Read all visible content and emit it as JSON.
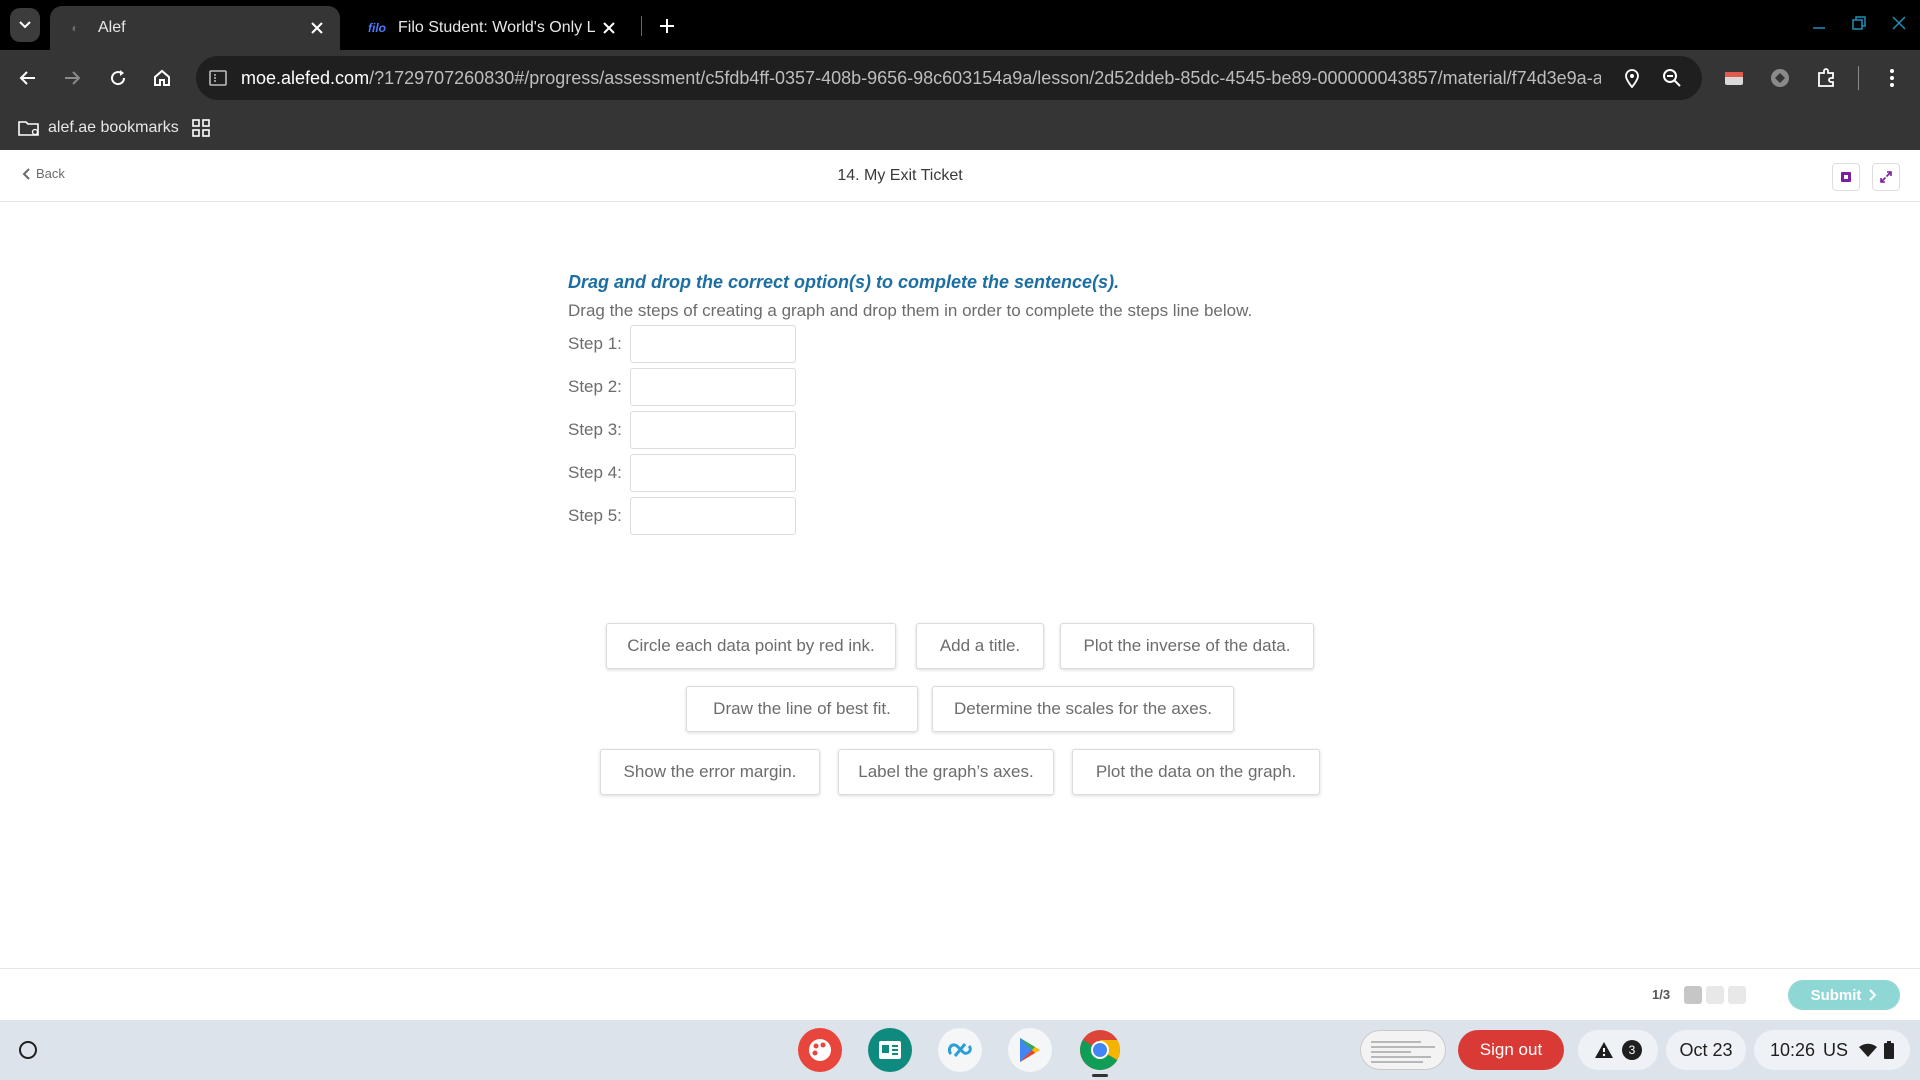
{
  "browser": {
    "tabs": [
      {
        "title": "Alef",
        "active": true,
        "favicon": "alef-icon"
      },
      {
        "title": "Filo Student: World's Only Live I",
        "active": false,
        "favicon": "filo-icon",
        "favicon_text": "filo"
      }
    ],
    "url_host": "moe.alefed.com",
    "url_rest": "/?1729707260830#/progress/assessment/c5fdb4ff-0357-408b-9656-98c603154a9a/lesson/2d52ddeb-85dc-4545-be89-000000043857/material/f74d3e9a-a...",
    "bookmarks": [
      {
        "label": "alef.ae bookmarks",
        "icon": "folder-icon"
      }
    ]
  },
  "page": {
    "back_label": "Back",
    "title": "14. My Exit Ticket",
    "instruction": "Drag and drop the correct option(s) to complete the sentence(s).",
    "subtitle": "Drag the steps of creating a graph and drop them in order to complete the steps line below.",
    "steps": [
      "Step 1:",
      "Step 2:",
      "Step 3:",
      "Step 4:",
      "Step 5:"
    ],
    "options": [
      "Circle each data point by red ink.",
      "Add a title.",
      "Plot the inverse of the data.",
      "Draw the line of best fit.",
      "Determine the scales for the axes.",
      "Show the error margin.",
      "Label the graph’s axes.",
      "Plot the data on the graph."
    ],
    "footer": {
      "pager": "1/3",
      "submit_label": "Submit"
    }
  },
  "shelf": {
    "signout_label": "Sign out",
    "notification_count": "3",
    "date": "Oct 23",
    "time": "10:26",
    "locale": "US"
  },
  "colors": {
    "instruction": "#1c6fa3",
    "submit": "#8fd7d4",
    "signout": "#d93a35"
  }
}
